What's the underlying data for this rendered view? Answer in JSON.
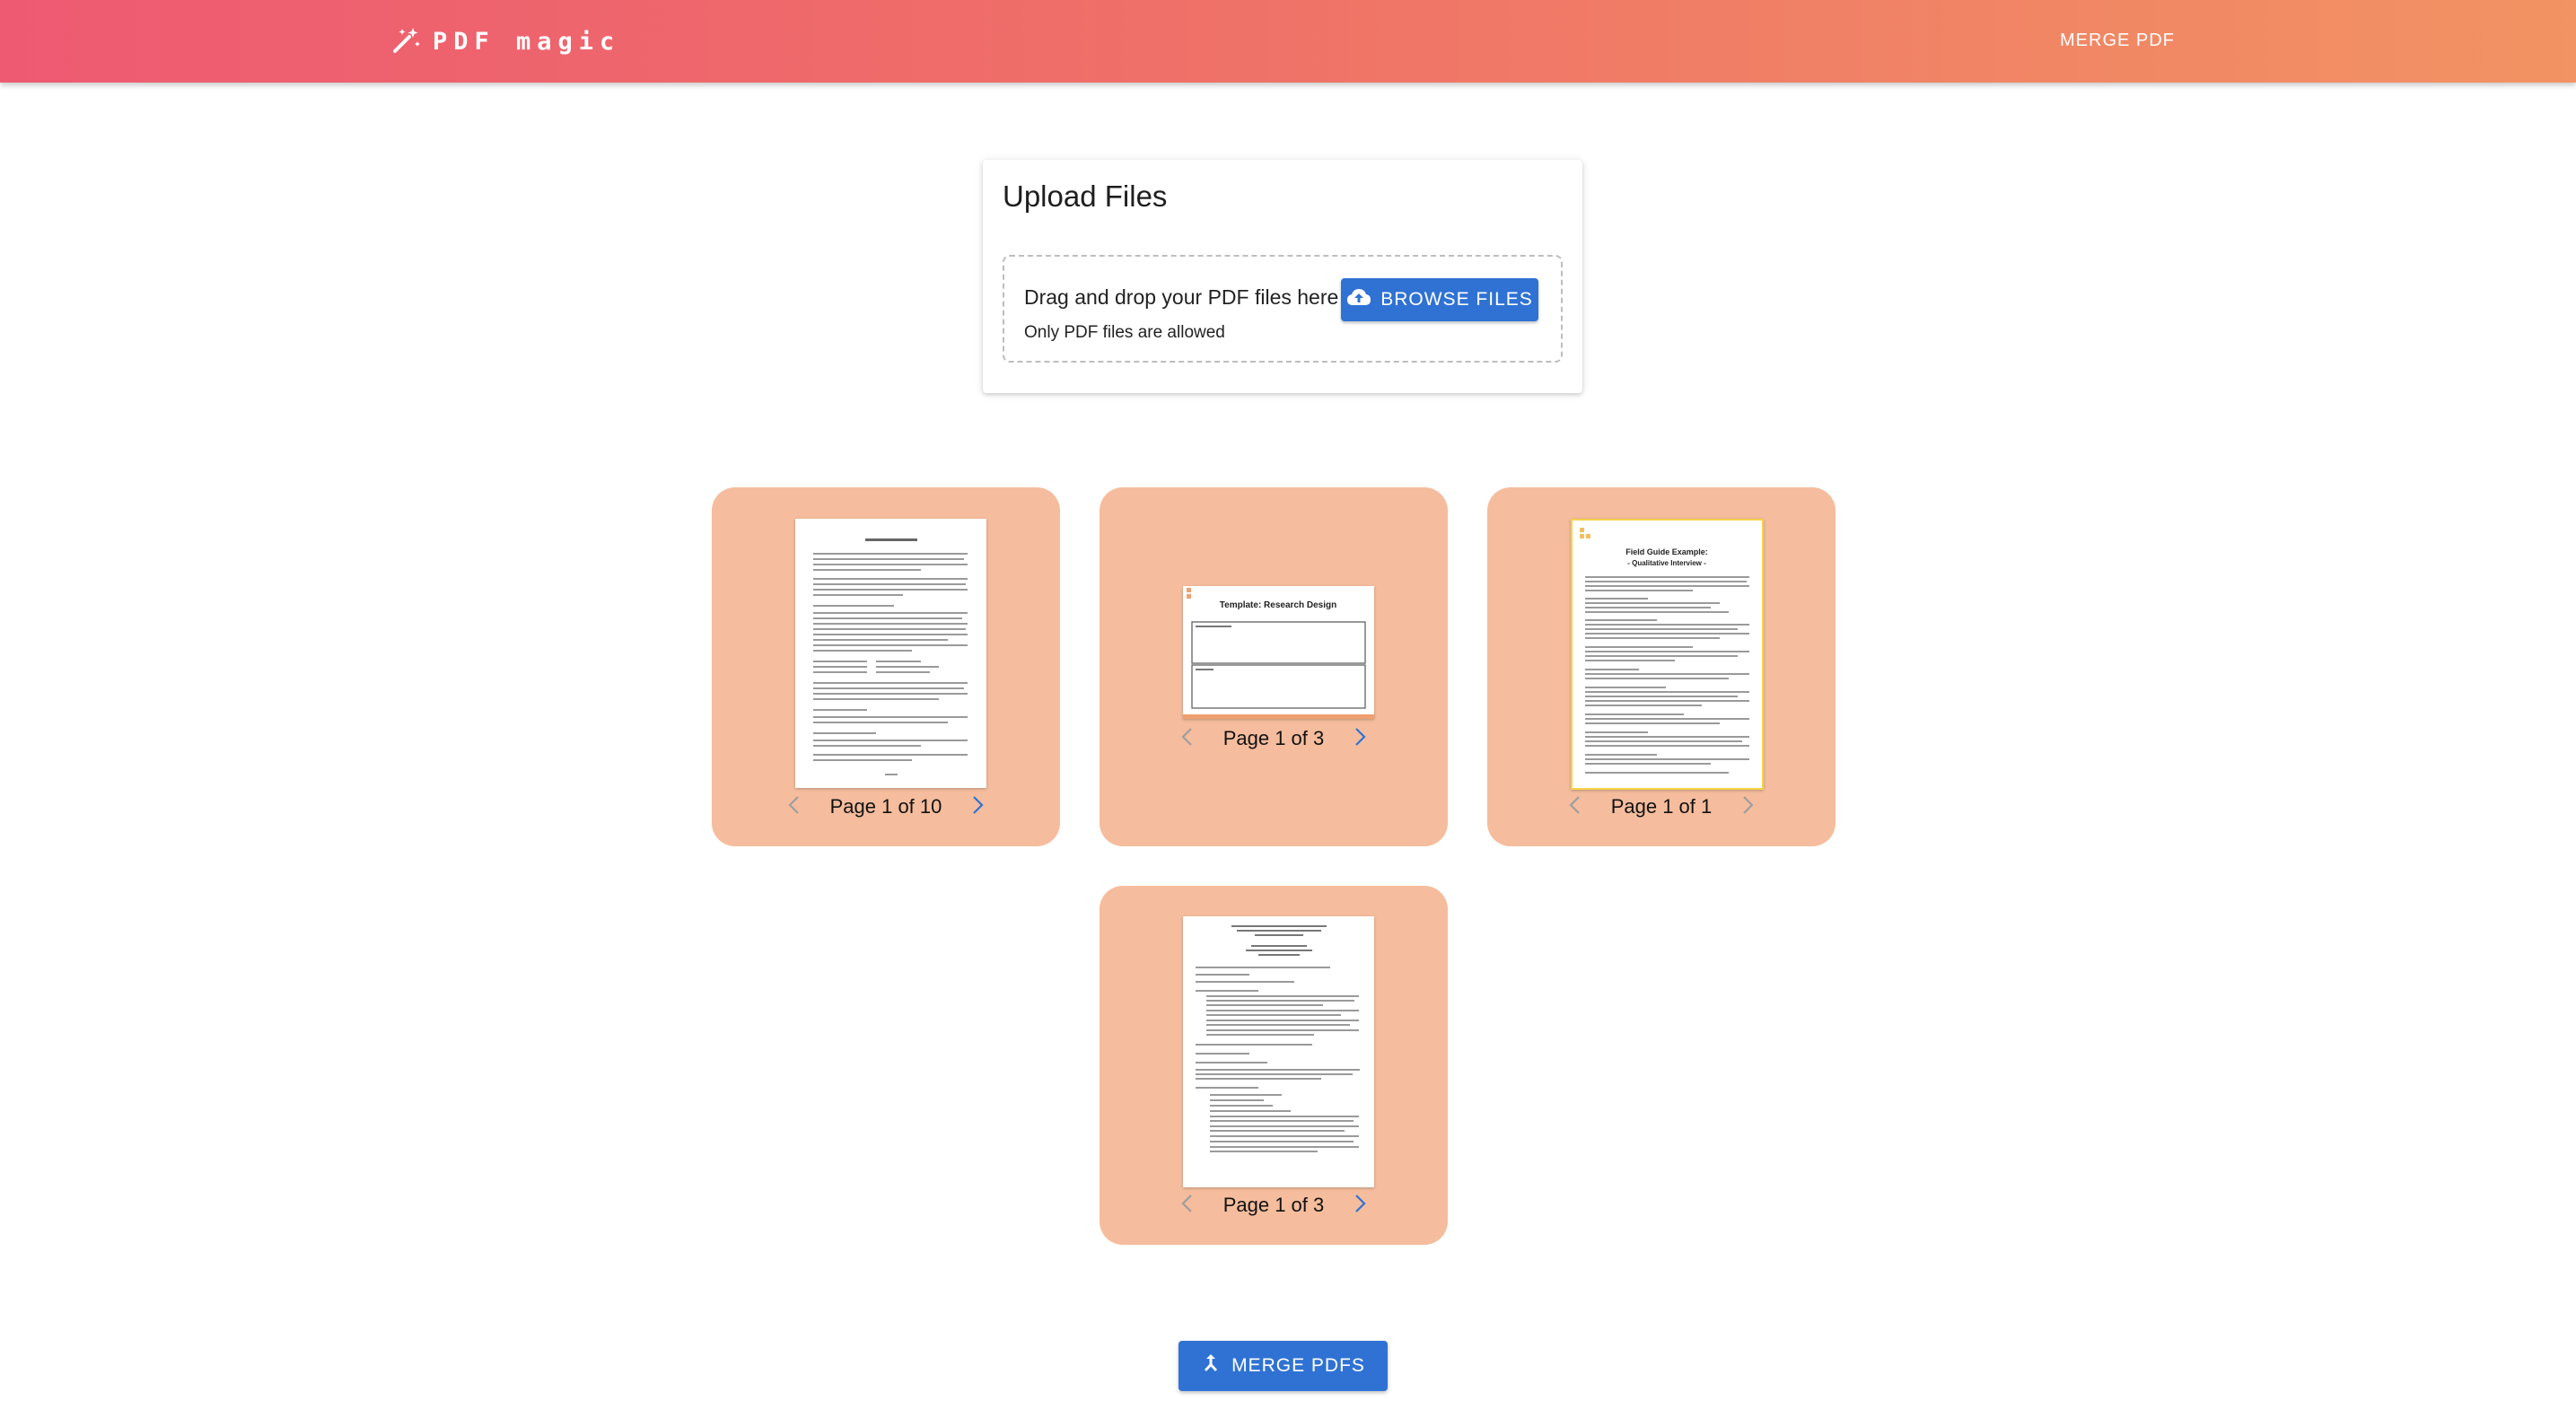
{
  "header": {
    "brand": "PDF magic",
    "nav_merge": "MERGE PDF"
  },
  "upload": {
    "title": "Upload Files",
    "drop_text": "Drag and drop your PDF files here or",
    "browse_label": "BROWSE FILES",
    "hint": "Only PDF files are allowed"
  },
  "files": [
    {
      "page_label": "Page 1 of 10",
      "thumb_title": ""
    },
    {
      "page_label": "Page 1 of 3",
      "thumb_title": "Template: Research Design"
    },
    {
      "page_label": "Page 1 of 1",
      "thumb_title": "Field Guide Example: - Qualitative Interview -"
    },
    {
      "page_label": "Page 1 of 3",
      "thumb_title": ""
    }
  ],
  "merge_label": "MERGE PDFS",
  "colors": {
    "accent": "#2f72d4",
    "card": "#f5bd9d",
    "header_start": "#ee5a72",
    "header_end": "#f29363"
  }
}
